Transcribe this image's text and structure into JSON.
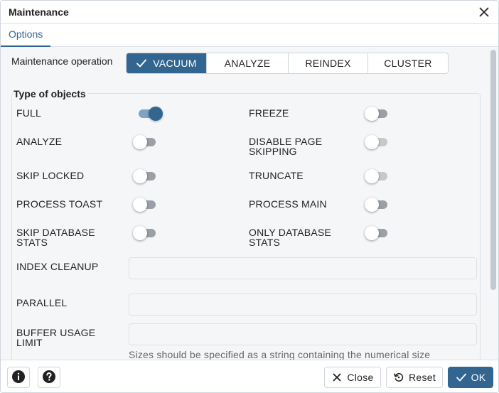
{
  "dialog": {
    "title": "Maintenance",
    "close_icon": "close-icon"
  },
  "tabs": [
    {
      "label": "Options",
      "active": true
    }
  ],
  "operation": {
    "label": "Maintenance operation",
    "options": [
      "VACUUM",
      "ANALYZE",
      "REINDEX",
      "CLUSTER"
    ],
    "selected": "VACUUM"
  },
  "type_of_objects": {
    "legend": "Type of objects",
    "toggles": [
      {
        "label": "FULL",
        "on": true,
        "disabled": false
      },
      {
        "label": "FREEZE",
        "on": false,
        "disabled": false
      },
      {
        "label": "ANALYZE",
        "on": false,
        "disabled": false
      },
      {
        "label": "DISABLE PAGE SKIPPING",
        "on": false,
        "disabled": true
      },
      {
        "label": "SKIP LOCKED",
        "on": false,
        "disabled": false
      },
      {
        "label": "TRUNCATE",
        "on": false,
        "disabled": true
      },
      {
        "label": "PROCESS TOAST",
        "on": false,
        "disabled": false
      },
      {
        "label": "PROCESS MAIN",
        "on": false,
        "disabled": false
      },
      {
        "label": "SKIP DATABASE STATS",
        "on": false,
        "disabled": false
      },
      {
        "label": "ONLY DATABASE STATS",
        "on": false,
        "disabled": false
      }
    ],
    "inputs": [
      {
        "label": "INDEX CLEANUP",
        "value": ""
      },
      {
        "label": "PARALLEL",
        "value": ""
      },
      {
        "label": "BUFFER USAGE LIMIT",
        "value": ""
      }
    ],
    "hint": "Sizes should be specified as a string containing the numerical size"
  },
  "footer": {
    "info_icon": "info-icon",
    "help_icon": "help-icon",
    "close_label": "Close",
    "reset_label": "Reset",
    "ok_label": "OK"
  },
  "colors": {
    "accent": "#326690",
    "panel_bg": "#f4f6f8",
    "border": "#dde2e8"
  }
}
